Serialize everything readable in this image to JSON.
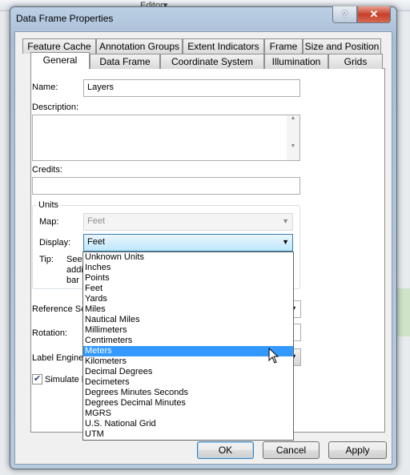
{
  "dialog": {
    "title": "Data Frame Properties",
    "help_label": "?",
    "close_label": "✕"
  },
  "tabs_row1": [
    "Feature Cache",
    "Annotation Groups",
    "Extent Indicators",
    "Frame",
    "Size and Position"
  ],
  "tabs_row2": [
    "General",
    "Data Frame",
    "Coordinate System",
    "Illumination",
    "Grids"
  ],
  "selected_tab": "General",
  "form": {
    "name_label": "Name:",
    "name_value": "Layers",
    "description_label": "Description:",
    "description_value": "",
    "credits_label": "Credits:",
    "credits_value": "",
    "units_label": "Units",
    "map_label": "Map:",
    "map_value": "Feet",
    "display_label": "Display:",
    "display_value": "Feet",
    "tip_label": "Tip:",
    "tip_lines": [
      "See",
      "addi",
      "bar"
    ],
    "reference_scale_label": "Reference Sc",
    "rotation_label": "Rotation:",
    "label_engine_label": "Label Engine:",
    "simulate_label": "Simulate la",
    "simulate_checked": true
  },
  "dropdown": {
    "items": [
      "Unknown Units",
      "Inches",
      "Points",
      "Feet",
      "Yards",
      "Miles",
      "Nautical Miles",
      "Millimeters",
      "Centimeters",
      "Meters",
      "Kilometers",
      "Decimal Degrees",
      "Decimeters",
      "Degrees Minutes Seconds",
      "Degrees Decimal Minutes",
      "MGRS",
      "U.S. National Grid",
      "UTM"
    ],
    "highlighted": "Meters"
  },
  "buttons": {
    "ok": "OK",
    "cancel": "Cancel",
    "apply": "Apply"
  },
  "background": {
    "toolbar_editor_label": "Editor▾"
  },
  "colors": {
    "highlight": "#3399ff",
    "close": "#c7402b"
  }
}
